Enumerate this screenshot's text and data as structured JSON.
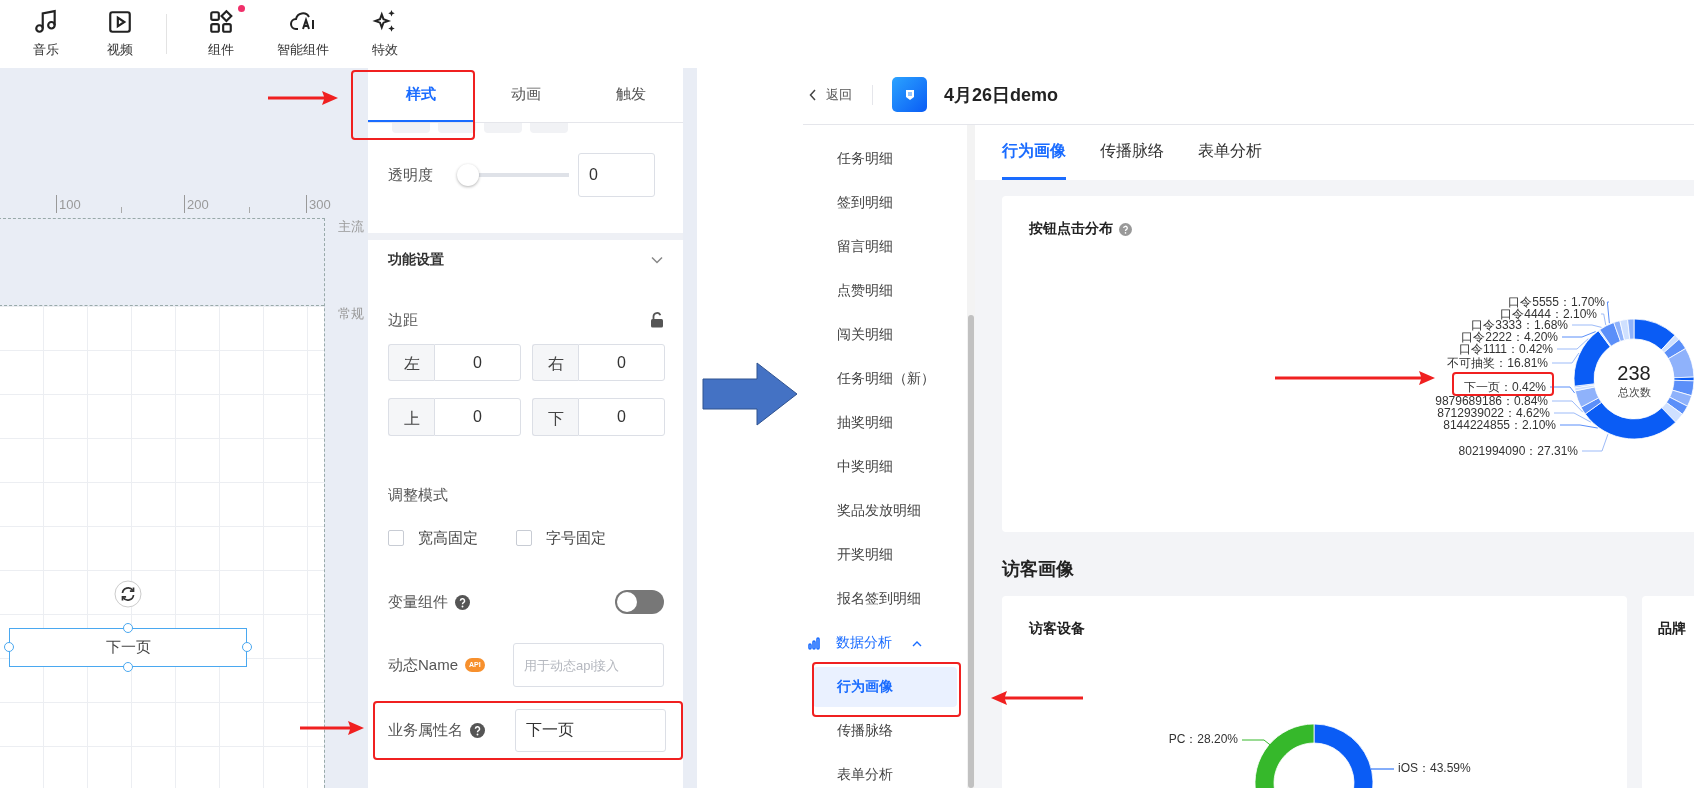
{
  "editor": {
    "toolbar": [
      {
        "label": "音乐",
        "badge": false
      },
      {
        "label": "视频",
        "badge": false
      },
      {
        "label": "组件",
        "badge": true
      },
      {
        "label": "智能组件",
        "badge": false
      },
      {
        "label": "特效",
        "badge": false
      }
    ],
    "canvas": {
      "ruler_marks": [
        "100",
        "200",
        "300"
      ],
      "guide_labels": [
        "主流",
        "常规"
      ],
      "selected_element": {
        "text": "下一页"
      }
    },
    "panel": {
      "tabs": [
        {
          "label": "样式",
          "selected": true
        },
        {
          "label": "动画",
          "selected": false
        },
        {
          "label": "触发",
          "selected": false
        }
      ],
      "opacity": {
        "label": "透明度",
        "level": 0,
        "value": "0"
      },
      "section": {
        "title": "功能设置",
        "expanded": true
      },
      "margin": {
        "label": "边距",
        "fields": [
          {
            "label": "左",
            "value": "0"
          },
          {
            "label": "右",
            "value": "0"
          },
          {
            "label": "上",
            "value": "0"
          },
          {
            "label": "下",
            "value": "0"
          }
        ]
      },
      "resize_mode": {
        "label": "调整模式",
        "options": [
          {
            "label": "宽高固定",
            "checked": false
          },
          {
            "label": "字号固定",
            "checked": false
          }
        ]
      },
      "variable_component": {
        "label": "变量组件",
        "on": false
      },
      "dynamic_name": {
        "label": "动态Name",
        "badge": "API",
        "placeholder": "用于动态api接入"
      },
      "business_attribute": {
        "label": "业务属性名",
        "value": "下一页"
      }
    }
  },
  "analytics": {
    "back": "返回",
    "title": "4月26日demo",
    "sidebar": [
      {
        "label": "任务明细",
        "selected": false
      },
      {
        "label": "签到明细",
        "selected": false
      },
      {
        "label": "留言明细",
        "selected": false
      },
      {
        "label": "点赞明细",
        "selected": false
      },
      {
        "label": "闯关明细",
        "selected": false
      },
      {
        "label": "任务明细（新）",
        "selected": false
      },
      {
        "label": "抽奖明细",
        "selected": false
      },
      {
        "label": "中奖明细",
        "selected": false
      },
      {
        "label": "奖品发放明细",
        "selected": false
      },
      {
        "label": "开奖明细",
        "selected": false
      },
      {
        "label": "报名签到明细",
        "selected": false
      },
      {
        "label": "数据分析",
        "kind": "group",
        "selected": false,
        "expanded": true,
        "children": [
          {
            "label": "行为画像",
            "selected": true
          },
          {
            "label": "传播脉络",
            "selected": false
          },
          {
            "label": "表单分析",
            "selected": false
          }
        ]
      }
    ],
    "tabs": [
      {
        "label": "行为画像",
        "selected": true
      },
      {
        "label": "传播脉络",
        "selected": false
      },
      {
        "label": "表单分析",
        "selected": false
      }
    ],
    "click_card": {
      "title": "按钮点击分布",
      "total": "238",
      "total_label": "总次数",
      "labels": [
        "口令5555：1.70%",
        "口令4444：2.10%",
        "口令3333：1.68%",
        "口令2222：4.20%",
        "口令1111：0.42%",
        "不可抽奖：16.81%",
        "下一页：0.42%",
        "9879689186：0.84%",
        "8712939022：4.62%",
        "8144224855：2.10%",
        "8021994090：27.31%"
      ]
    },
    "section_title": "访客画像",
    "device_card": {
      "title": "访客设备",
      "labels": [
        "PC：28.20%",
        "iOS：43.59%"
      ]
    },
    "brand_card": {
      "title": "品牌"
    }
  }
}
